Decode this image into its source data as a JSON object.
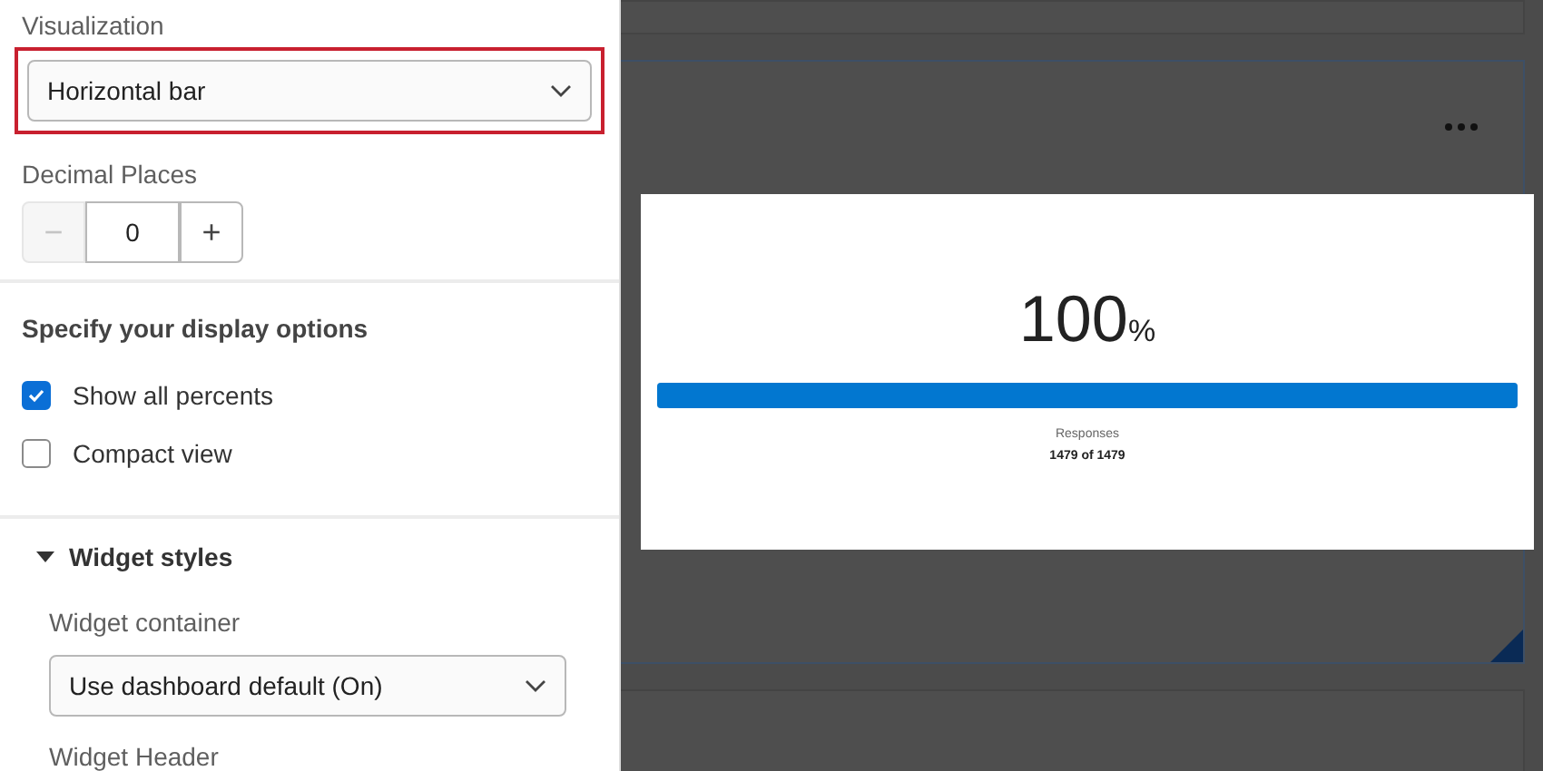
{
  "visualization": {
    "label": "Visualization",
    "value": "Horizontal bar",
    "highlighted": true
  },
  "decimal_places": {
    "label": "Decimal Places",
    "value": "0",
    "minus": "−",
    "plus": "+",
    "minus_disabled": true
  },
  "display_options": {
    "heading": "Specify your display options",
    "options": [
      {
        "label": "Show all percents",
        "checked": true
      },
      {
        "label": "Compact view",
        "checked": false
      }
    ]
  },
  "widget_styles": {
    "title": "Widget styles",
    "expanded": true,
    "container_label": "Widget container",
    "container_value": "Use dashboard default (On)",
    "header_label": "Widget Header"
  },
  "preview": {
    "value": "100",
    "unit": "%",
    "level": 1,
    "caption": "Responses",
    "count": "1479 of 1479"
  }
}
